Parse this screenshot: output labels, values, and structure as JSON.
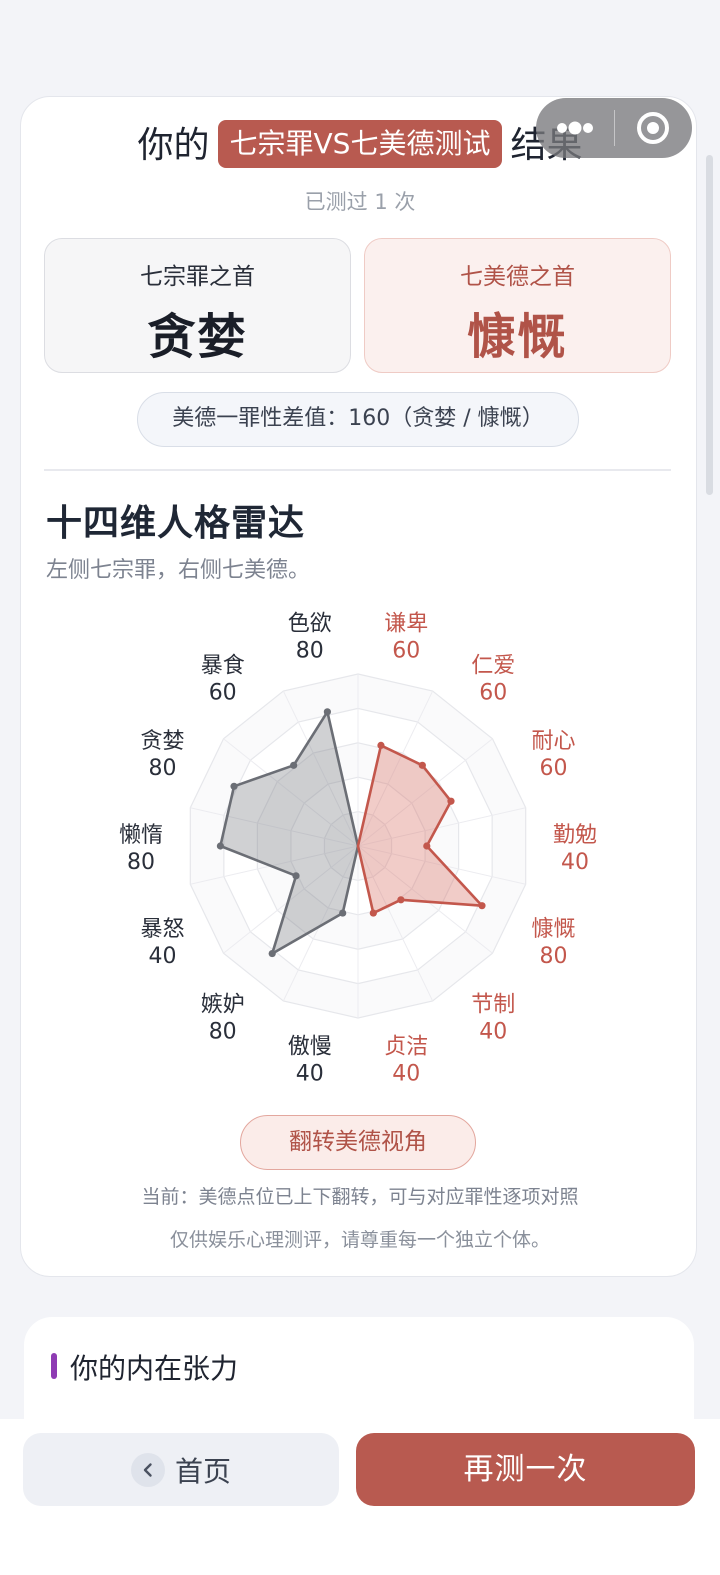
{
  "header": {
    "title_prefix": "你的",
    "test_name": "七宗罪VS七美德测试",
    "title_suffix": "结果",
    "tested_count": "已测过 1 次"
  },
  "summary": {
    "sin_label": "七宗罪之首",
    "sin_value": "贪婪",
    "virtue_label": "七美德之首",
    "virtue_value": "慷慨",
    "diff_text": "美德一罪性差值：160（贪婪 / 慷慨）"
  },
  "section": {
    "title": "十四维人格雷达",
    "subtitle": "左侧七宗罪，右侧七美德。"
  },
  "chart_data": {
    "type": "radar",
    "max": 100,
    "levels": 5,
    "sins": {
      "color": "#6b6e75",
      "axes": [
        {
          "name": "色欲",
          "value": 80
        },
        {
          "name": "暴食",
          "value": 60
        },
        {
          "name": "贪婪",
          "value": 80
        },
        {
          "name": "懒惰",
          "value": 80
        },
        {
          "name": "暴怒",
          "value": 40
        },
        {
          "name": "嫉妒",
          "value": 80
        },
        {
          "name": "傲慢",
          "value": 40
        }
      ]
    },
    "virtues": {
      "color": "#c3574c",
      "axes": [
        {
          "name": "谦卑",
          "value": 60
        },
        {
          "name": "仁爱",
          "value": 60
        },
        {
          "name": "耐心",
          "value": 60
        },
        {
          "name": "勤勉",
          "value": 40
        },
        {
          "name": "慷慨",
          "value": 80
        },
        {
          "name": "节制",
          "value": 40
        },
        {
          "name": "贞洁",
          "value": 40
        }
      ]
    }
  },
  "actions": {
    "flip_label": "翻转美德视角",
    "current_note": "当前：美德点位已上下翻转，可与对应罪性逐项对照",
    "disclaimer": "仅供娱乐心理测评，请尊重每一个独立个体。",
    "home_label": "首页",
    "retest_label": "再测一次"
  },
  "tension": {
    "title": "你的内在张力"
  },
  "colors": {
    "accent": "#b85a50",
    "sin": "#6b6e75",
    "virtue": "#c3574c",
    "tension_bar": "#8e3bb3"
  }
}
